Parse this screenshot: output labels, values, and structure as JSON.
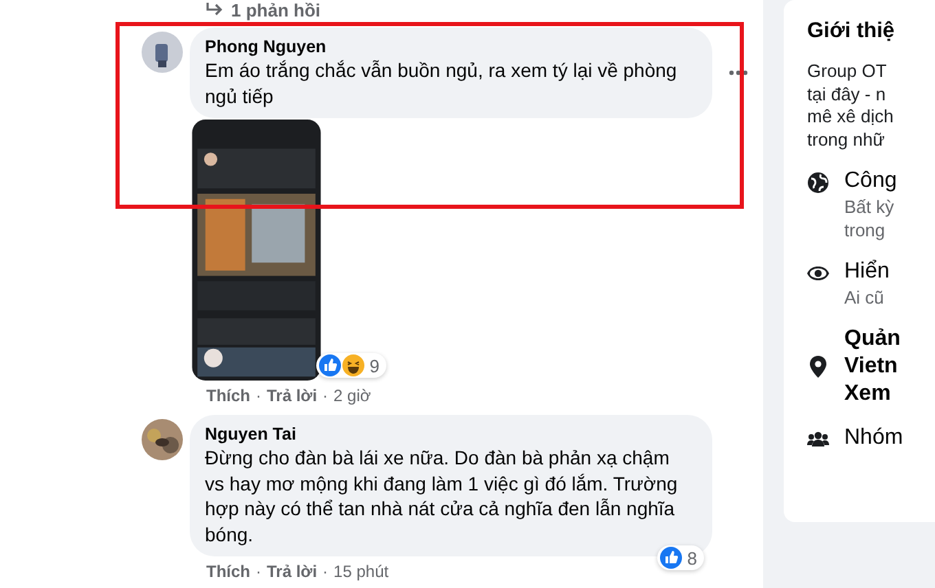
{
  "replies_link": {
    "text": "1 phản hồi"
  },
  "separator": "·",
  "comments": [
    {
      "author": "Phong Nguyen",
      "text": "Em áo trắng chắc vẫn buồn ngủ, ra xem tý lại về phòng ngủ tiếp",
      "highlighted": true,
      "menu_visible": true,
      "attachment": {
        "kind": "picture"
      },
      "reactions": {
        "icons": [
          {
            "kind": "like"
          },
          {
            "kind": "haha"
          }
        ],
        "count": "9"
      },
      "actions": [
        "Thích",
        "Trả lời"
      ],
      "time": "2 giờ"
    },
    {
      "author": "Nguyen Tai",
      "text": "Đừng cho đàn bà lái xe nữa. Do đàn bà phản xạ chậm vs hay mơ mộng khi đang làm 1 việc gì đó lắm. Trường hợp này có thể tan nhà nát cửa cả nghĩa đen lẫn nghĩa bóng.",
      "highlighted": false,
      "menu_visible": false,
      "reactions": {
        "icons": [
          {
            "kind": "like"
          }
        ],
        "count": "8"
      },
      "actions": [
        "Thích",
        "Trả lời"
      ],
      "time": "15 phút"
    }
  ],
  "about": {
    "title": "Giới thiệ",
    "description": [
      "Group OT",
      "tại đây - n",
      "mê xê dịch",
      "trong nhữ"
    ],
    "items": [
      {
        "kind": "globe",
        "title": "Công",
        "lines": [
          "Bất kỳ",
          "trong"
        ]
      },
      {
        "kind": "eye",
        "title": "Hiển",
        "lines": [
          "Ai cũ"
        ]
      },
      {
        "kind": "pin",
        "title_lines": [
          "Quản",
          "Vietn",
          "Xem"
        ]
      },
      {
        "kind": "people",
        "title": "Nhóm"
      }
    ]
  }
}
